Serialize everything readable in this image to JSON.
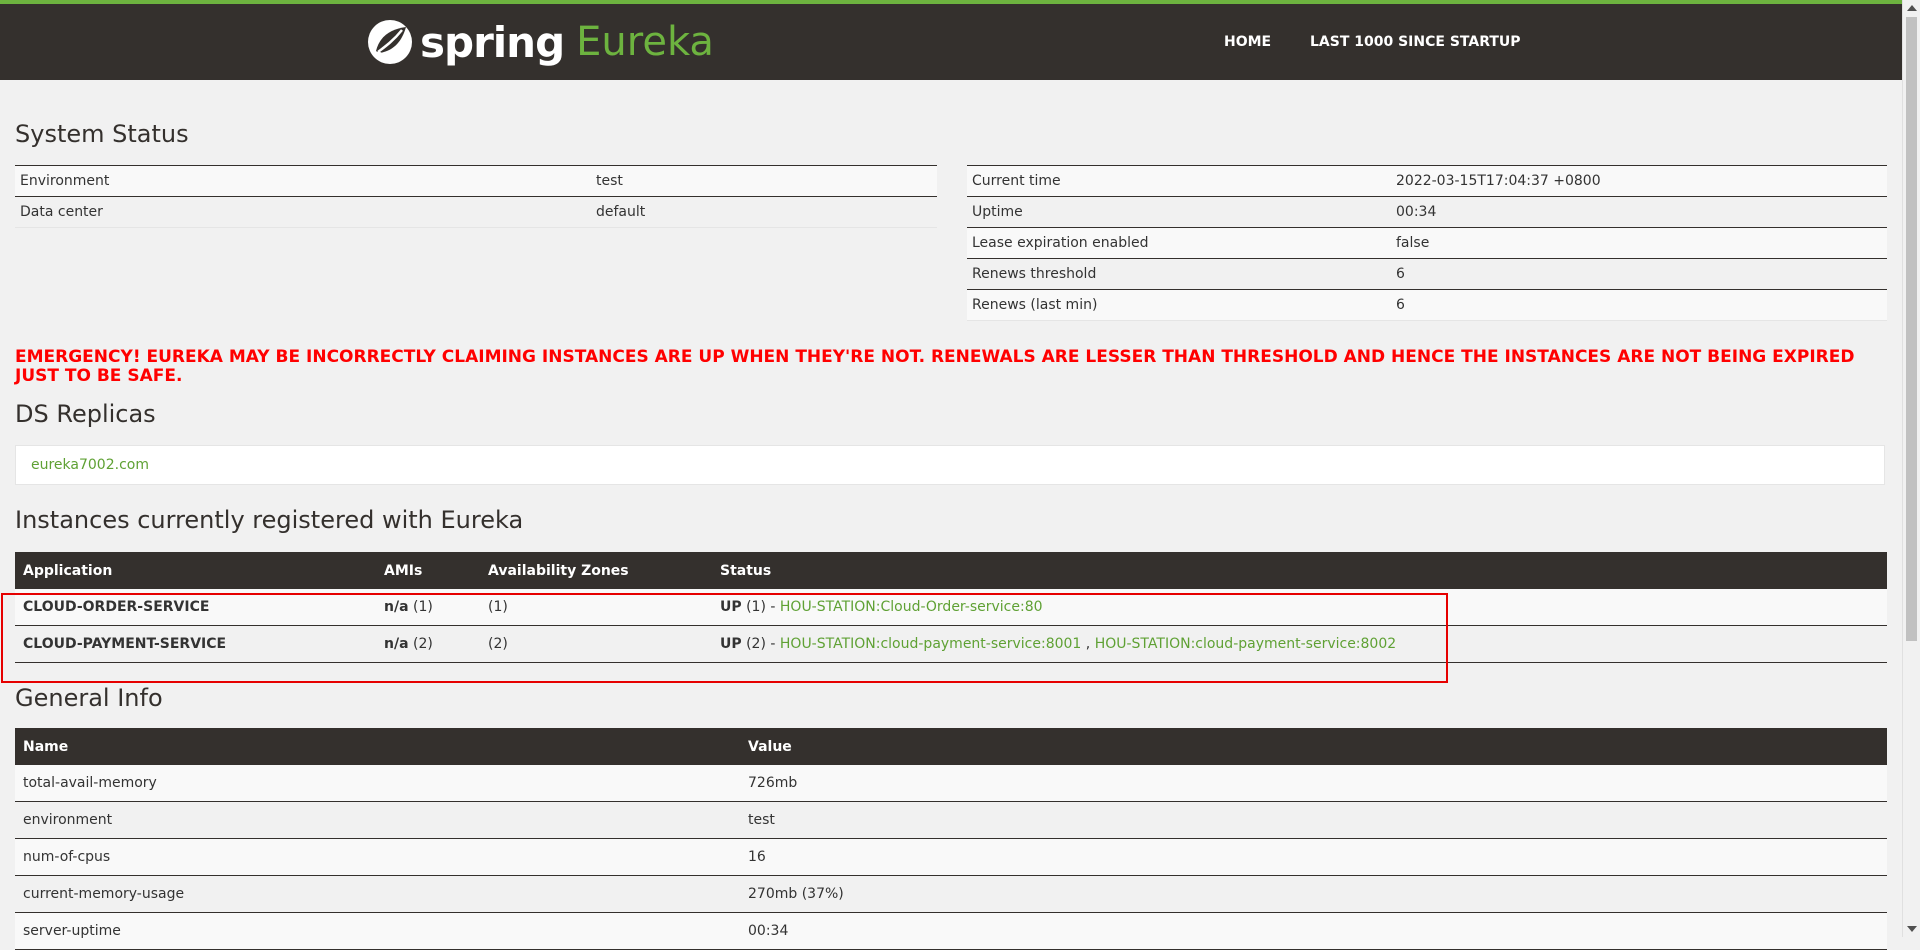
{
  "nav": {
    "brand_spring": "spring",
    "brand_eureka": "Eureka",
    "home": "HOME",
    "last1000": "LAST 1000 SINCE STARTUP"
  },
  "system_status": {
    "title": "System Status",
    "left": [
      {
        "name": "Environment",
        "value": "test"
      },
      {
        "name": "Data center",
        "value": "default"
      }
    ],
    "right": [
      {
        "name": "Current time",
        "value": "2022-03-15T17:04:37 +0800"
      },
      {
        "name": "Uptime",
        "value": "00:34"
      },
      {
        "name": "Lease expiration enabled",
        "value": "false"
      },
      {
        "name": "Renews threshold",
        "value": "6"
      },
      {
        "name": "Renews (last min)",
        "value": "6"
      }
    ]
  },
  "emergency": "EMERGENCY! EUREKA MAY BE INCORRECTLY CLAIMING INSTANCES ARE UP WHEN THEY'RE NOT. RENEWALS ARE LESSER THAN THRESHOLD AND HENCE THE INSTANCES ARE NOT BEING EXPIRED JUST TO BE SAFE.",
  "ds_replicas": {
    "title": "DS Replicas",
    "replica": "eureka7002.com"
  },
  "instances": {
    "title": "Instances currently registered with Eureka",
    "headers": [
      "Application",
      "AMIs",
      "Availability Zones",
      "Status"
    ],
    "rows": [
      {
        "app": "CLOUD-ORDER-SERVICE",
        "amis_bold": "n/a",
        "amis_count": "(1)",
        "zones": "(1)",
        "status_bold": "UP",
        "status_count": "(1) -",
        "links": [
          "HOU-STATION:Cloud-Order-service:80"
        ],
        "separator": ""
      },
      {
        "app": "CLOUD-PAYMENT-SERVICE",
        "amis_bold": "n/a",
        "amis_count": "(2)",
        "zones": "(2)",
        "status_bold": "UP",
        "status_count": "(2) -",
        "links": [
          "HOU-STATION:cloud-payment-service:8001",
          "HOU-STATION:cloud-payment-service:8002"
        ],
        "separator": ","
      }
    ]
  },
  "general_info": {
    "title": "General Info",
    "headers": [
      "Name",
      "Value"
    ],
    "rows": [
      {
        "name": "total-avail-memory",
        "value": "726mb"
      },
      {
        "name": "environment",
        "value": "test"
      },
      {
        "name": "num-of-cpus",
        "value": "16"
      },
      {
        "name": "current-memory-usage",
        "value": "270mb (37%)"
      },
      {
        "name": "server-uptime",
        "value": "00:34"
      }
    ]
  },
  "colors": {
    "brand_green": "#6db33f",
    "nav_bg": "#34302d",
    "emergency_red": "#ff0000",
    "link_green": "#5fa134"
  }
}
